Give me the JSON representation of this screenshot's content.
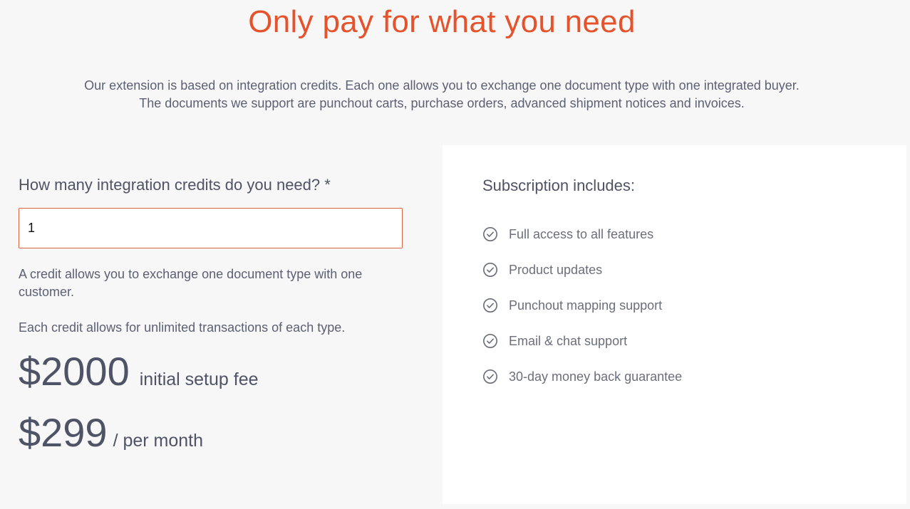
{
  "header": {
    "title": "Only pay for what you need",
    "intro_line1": "Our extension is based on integration credits. Each one allows you to exchange one document type with one integrated buyer.",
    "intro_line2": "The documents we support are punchout carts, purchase orders, advanced shipment notices and invoices."
  },
  "calculator": {
    "question": "How many integration credits do you need? *",
    "credits_value": "1",
    "note1": "A credit allows you to exchange one document type with one customer.",
    "note2": "Each credit allows for unlimited transactions of each type.",
    "setup_price": "$2000",
    "setup_label": "initial setup fee",
    "monthly_price": "$299",
    "monthly_label": "/ per month"
  },
  "subscription": {
    "title": "Subscription includes:",
    "features": [
      {
        "label": "Full access to all features",
        "icon": "check-circle-icon"
      },
      {
        "label": "Product updates",
        "icon": "check-circle-icon"
      },
      {
        "label": "Punchout mapping support",
        "icon": "check-circle-icon"
      },
      {
        "label": "Email & chat support",
        "icon": "check-circle-icon"
      },
      {
        "label": "30-day money back guarantee",
        "icon": "check-circle-icon"
      }
    ]
  },
  "colors": {
    "accent": "#e4532b",
    "text": "#4e5365",
    "panel_bg": "#ffffff",
    "page_bg": "#f7f7f7"
  }
}
